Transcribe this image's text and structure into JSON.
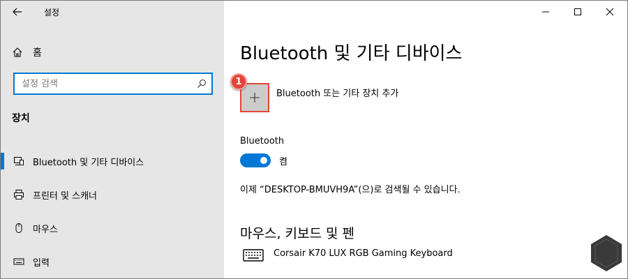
{
  "app": {
    "title": "설정"
  },
  "sidebar": {
    "home_label": "홈",
    "search": {
      "placeholder": "설정 검색"
    },
    "section": "장치",
    "items": [
      {
        "label": "Bluetooth 및 기타 디바이스",
        "icon": "bluetooth-devices-icon",
        "selected": true
      },
      {
        "label": "프린터 및 스캐너",
        "icon": "printer-icon",
        "selected": false
      },
      {
        "label": "마우스",
        "icon": "mouse-icon",
        "selected": false
      },
      {
        "label": "입력",
        "icon": "keyboard-icon",
        "selected": false
      }
    ]
  },
  "main": {
    "title": "Bluetooth 및 기타 디바이스",
    "add_device": {
      "label": "Bluetooth 또는 기타 장치 추가",
      "badge": "1"
    },
    "bluetooth": {
      "label": "Bluetooth",
      "state": "켬",
      "on": true
    },
    "discoverable": "이제 “DESKTOP-BMUVH9A”(으)로 검색될 수 있습니다.",
    "section_heading": "마우스, 키보드 및 펜",
    "devices": [
      {
        "name": "Corsair K70 LUX RGB Gaming Keyboard",
        "icon": "keyboard-icon"
      }
    ]
  },
  "colors": {
    "accent": "#0078d7",
    "sidebar_bg": "#e6e6e6",
    "highlight_red": "#e2463b"
  }
}
